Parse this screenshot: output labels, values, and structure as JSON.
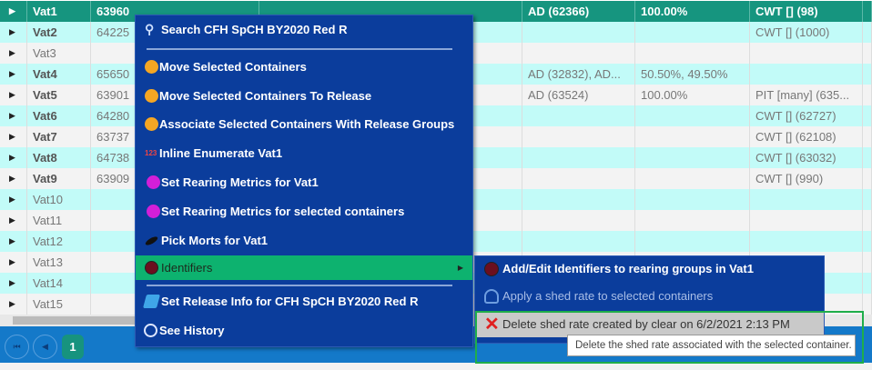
{
  "grid": {
    "rows": [
      {
        "name": "Vat1",
        "id": "63960",
        "ad": "AD (62366)",
        "pct": "100.00%",
        "tag": "CWT [] (98)",
        "style": "sel"
      },
      {
        "name": "Vat2",
        "id": "64225",
        "ad": "",
        "pct": "",
        "tag": "CWT [] (1000)",
        "style": "a"
      },
      {
        "name": "Vat3",
        "id": "",
        "ad": "",
        "pct": "",
        "tag": "",
        "style": "b"
      },
      {
        "name": "Vat4",
        "id": "65650",
        "ad": "AD (32832), AD...",
        "pct": "50.50%, 49.50%",
        "tag": "",
        "style": "a"
      },
      {
        "name": "Vat5",
        "id": "63901",
        "ad": "AD (63524)",
        "pct": "100.00%",
        "tag": "PIT [many] (635...",
        "style": "b"
      },
      {
        "name": "Vat6",
        "id": "64280",
        "ad": "",
        "pct": "",
        "tag": "CWT [] (62727)",
        "style": "a"
      },
      {
        "name": "Vat7",
        "id": "63737",
        "ad": "",
        "pct": "",
        "tag": "CWT [] (62108)",
        "style": "b"
      },
      {
        "name": "Vat8",
        "id": "64738",
        "ad": "",
        "pct": "",
        "tag": "CWT [] (63032)",
        "style": "a"
      },
      {
        "name": "Vat9",
        "id": "63909",
        "ad": "",
        "pct": "",
        "tag": "CWT [] (990)",
        "style": "b"
      },
      {
        "name": "Vat10",
        "id": "",
        "ad": "",
        "pct": "",
        "tag": "",
        "style": "a"
      },
      {
        "name": "Vat11",
        "id": "",
        "ad": "",
        "pct": "",
        "tag": "",
        "style": "b"
      },
      {
        "name": "Vat12",
        "id": "",
        "ad": "",
        "pct": "",
        "tag": "",
        "style": "a"
      },
      {
        "name": "Vat13",
        "id": "",
        "ad": "",
        "pct": "",
        "tag": "",
        "style": "b"
      },
      {
        "name": "Vat14",
        "id": "",
        "ad": "",
        "pct": "",
        "tag": "",
        "style": "a"
      },
      {
        "name": "Vat15",
        "id": "",
        "ad": "",
        "pct": "",
        "tag": "",
        "style": "b"
      }
    ]
  },
  "pager": {
    "first": "⏮",
    "prev": "◀",
    "page": "1"
  },
  "menu": {
    "items": [
      {
        "label": "Search CFH SpCH BY2020 Red R",
        "icon": "search-icon"
      },
      {
        "label": "Move Selected Containers",
        "icon": "move-icon"
      },
      {
        "label": "Move Selected Containers To Release",
        "icon": "move-icon"
      },
      {
        "label": "Associate Selected Containers With Release Groups",
        "icon": "associate-icon"
      },
      {
        "label": "Inline Enumerate Vat1",
        "icon": "enumerate-icon"
      },
      {
        "label": "Set Rearing Metrics for Vat1",
        "icon": "pin-icon"
      },
      {
        "label": "Set Rearing Metrics for selected containers",
        "icon": "pin-icon"
      },
      {
        "label": "Pick Morts for Vat1",
        "icon": "fish-icon"
      },
      {
        "label": "Identifiers",
        "icon": "id-icon"
      },
      {
        "label": "Set Release Info for CFH SpCH BY2020 Red R",
        "icon": "release-icon"
      },
      {
        "label": "See History",
        "icon": "clock-icon"
      }
    ]
  },
  "submenu": {
    "items": [
      {
        "label": "Add/Edit Identifiers to rearing groups in Vat1",
        "icon": "id-icon"
      },
      {
        "label": "Apply a shed rate to selected containers",
        "icon": "shed-icon"
      },
      {
        "label": "Delete shed rate created by clear on 6/2/2021 2:13 PM",
        "icon": "delete-x-icon"
      }
    ]
  },
  "tooltip": "Delete the shed rate associated with the selected container.",
  "colors": {
    "selected_row": "#16957f",
    "menu_bg": "#0b3d9c",
    "highlight": "#0db26f",
    "pager": "#1479c9"
  }
}
